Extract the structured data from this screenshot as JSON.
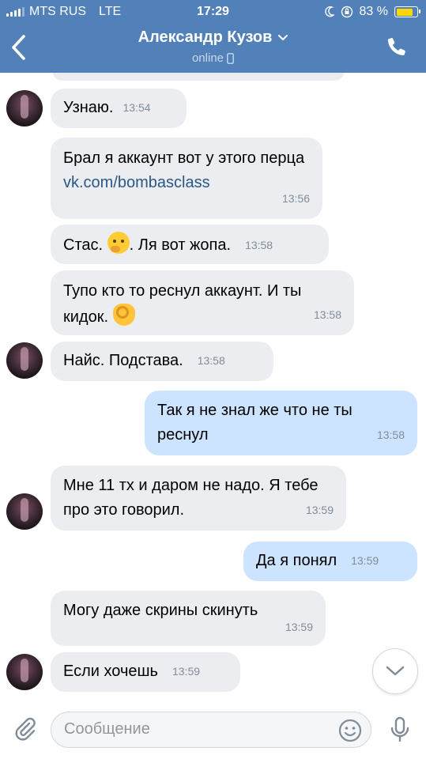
{
  "status_bar": {
    "carrier": "MTS RUS",
    "network": "LTE",
    "time": "17:29",
    "battery": "83 %",
    "battery_level": 0.83
  },
  "header": {
    "contact_name": "Александр Кузов",
    "status": "online",
    "color": "#5181b8"
  },
  "messages": [
    {
      "dir": "in",
      "text": "Узнаю.",
      "time": "13:54"
    },
    {
      "dir": "in",
      "text": "Брал я аккаунт вот у этого перца ",
      "link": "vk.com/bombasclass",
      "time": "13:56"
    },
    {
      "dir": "in",
      "text_before": "Стас. ",
      "emoji": "thinking-face",
      "text_after": ". Ля вот жопа.",
      "time": "13:58"
    },
    {
      "dir": "in",
      "text": "Тупо кто то реснул аккаунт. И ты кидок. ",
      "emoji": "ok-hand",
      "time": "13:58"
    },
    {
      "dir": "in",
      "text": "Найс. Подстава.",
      "time": "13:58"
    },
    {
      "dir": "out",
      "text": "Так я не знал же что не ты реснул",
      "time": "13:58"
    },
    {
      "dir": "in",
      "text": "Мне 11 тх и даром не надо. Я тебе про это говорил.",
      "time": "13:59"
    },
    {
      "dir": "out",
      "text": "Да я понял",
      "time": "13:59"
    },
    {
      "dir": "in",
      "text": "Могу даже скрины скинуть",
      "time": "13:59"
    },
    {
      "dir": "in",
      "text": "Если хочешь",
      "time": "13:59"
    }
  ],
  "input": {
    "placeholder": "Сообщение"
  },
  "icons": {
    "back": "chevron-left-icon",
    "phone": "phone-icon",
    "attach": "paperclip-icon",
    "emoji": "smile-icon",
    "mic": "microphone-icon",
    "scroll": "chevron-down-icon"
  }
}
